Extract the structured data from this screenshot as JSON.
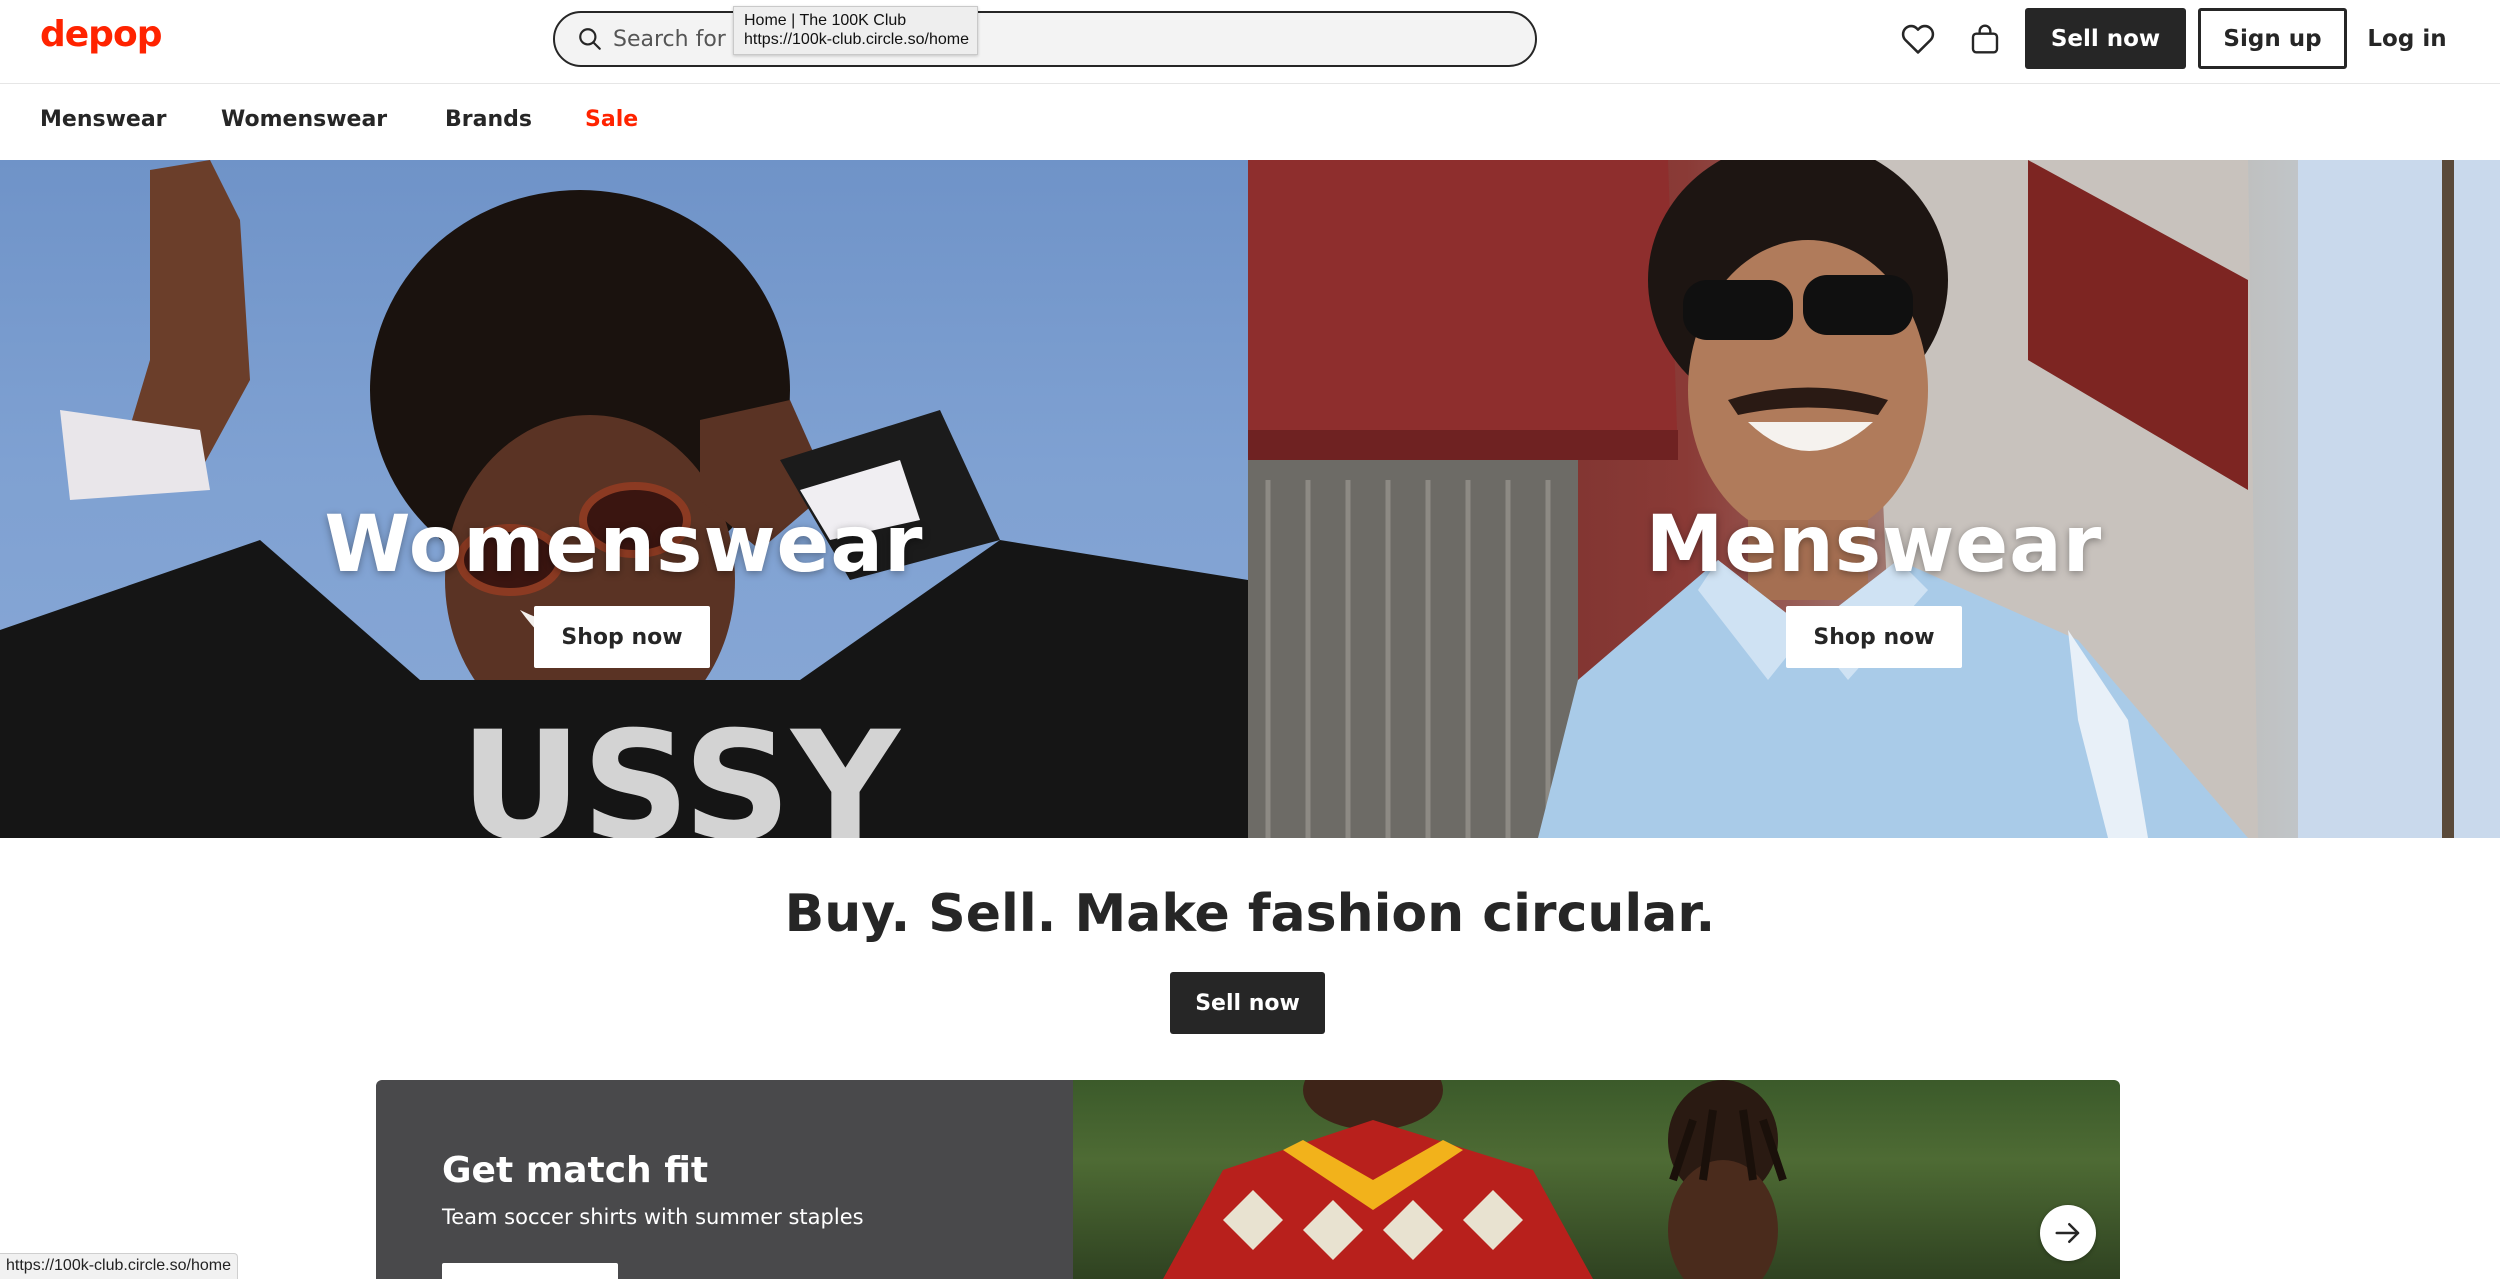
{
  "header": {
    "logo": "depop",
    "search_placeholder": "Search for \"",
    "sell_label": "Sell now",
    "signup_label": "Sign up",
    "login_label": "Log in"
  },
  "tooltip": {
    "title": "Home | The 100K Club",
    "url": "https://100k-club.circle.so/home"
  },
  "nav": {
    "items": [
      {
        "label": "Menswear"
      },
      {
        "label": "Womenswear"
      },
      {
        "label": "Brands"
      },
      {
        "label": "Sale",
        "color": "#ff2300"
      }
    ]
  },
  "hero": {
    "panels": [
      {
        "title": "Womenswear",
        "button": "Shop now"
      },
      {
        "title": "Menswear",
        "button": "Shop now"
      }
    ]
  },
  "tagline": {
    "text": "Buy. Sell. Make fashion circular.",
    "button": "Sell now"
  },
  "promo": {
    "title": "Get match fit",
    "subtitle": "Team soccer shirts with summer staples"
  },
  "statusbar": {
    "url": "https://100k-club.circle.so/home"
  },
  "colors": {
    "brand": "#ff2300",
    "dark": "#262626",
    "promo_bg": "#49494b"
  },
  "icons": [
    "search-icon",
    "heart-icon",
    "shopping-bag-icon",
    "arrow-right-icon"
  ]
}
